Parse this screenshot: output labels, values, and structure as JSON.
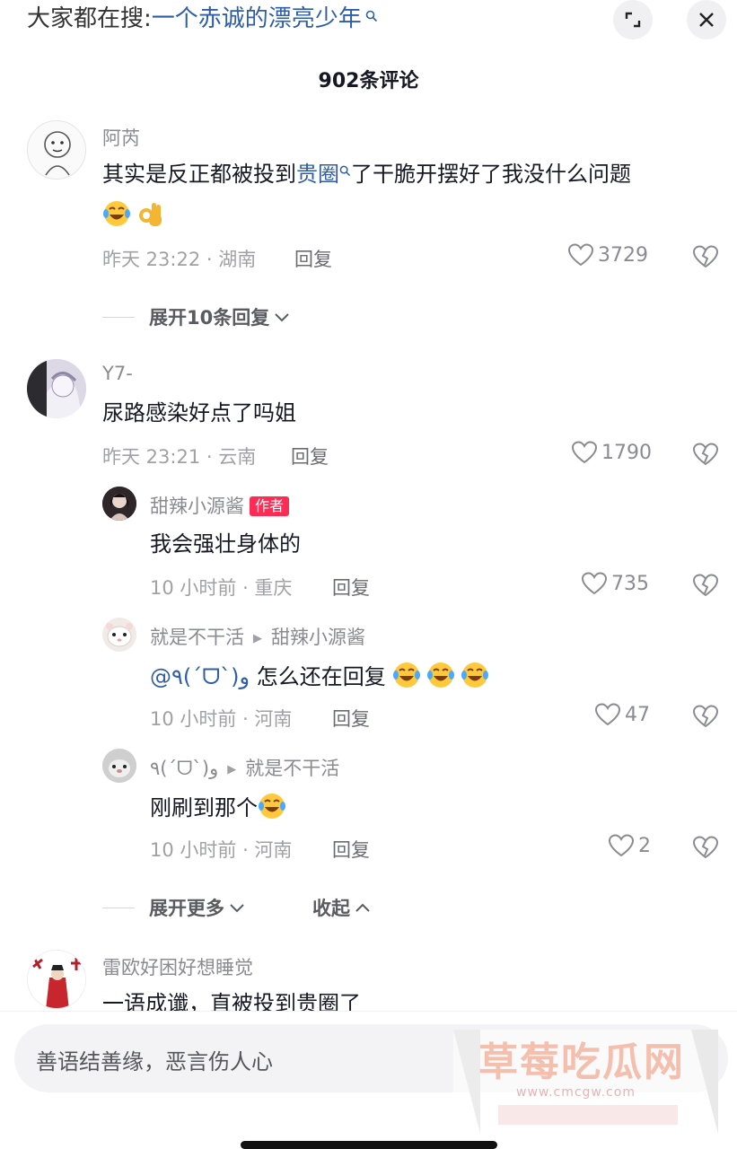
{
  "header": {
    "hint_prefix": "大家都在搜:",
    "hint_keyword": "一个赤诚的漂亮少年",
    "comment_count": "902条评论"
  },
  "comments": [
    {
      "user": "阿芮",
      "text_before": "其实是反正都被投到",
      "link": "贵圈",
      "text_after": "了干脆开摆好了我没什么问题",
      "time_location": "昨天 23:22 · 湖南",
      "reply": "回复",
      "likes": "3729"
    },
    {
      "user": "Y7-",
      "text": "尿路感染好点了吗姐",
      "time_location": "昨天 23:21 · 云南",
      "reply": "回复",
      "likes": "1790"
    },
    {
      "user": "雷欧好困好想睡觉",
      "text": "一语成谶，直被投到贵圈了"
    }
  ],
  "expand_first": "展开10条回复",
  "replies": [
    {
      "user": "甜辣小源酱",
      "badge": "作者",
      "text": "我会强壮身体的",
      "time_location": "10 小时前 · 重庆",
      "reply": "回复",
      "likes": "735"
    },
    {
      "user": "就是不干活",
      "reply_to": "甜辣小源酱",
      "mention": "@٩(ˊᗜˋ)و",
      "text": " 怎么还在回复",
      "time_location": "10 小时前 · 河南",
      "reply": "回复",
      "likes": "47"
    },
    {
      "user": "٩(ˊᗜˋ)و",
      "reply_to": "就是不干活",
      "text": "刚刷到那个",
      "time_location": "10 小时前 · 河南",
      "reply": "回复",
      "likes": "2"
    }
  ],
  "expand_more": "展开更多",
  "collapse": "收起",
  "input": {
    "placeholder": "善语结善缘，恶言伤人心"
  },
  "watermark": {
    "title": "草莓吃瓜网",
    "url": "www.cmcgw.com"
  },
  "colors": {
    "link": "#2f5ea8",
    "author_badge": "#fe2c55"
  },
  "icons": [
    "search-icon",
    "expand-icon",
    "close-icon",
    "heart-icon",
    "broken-heart-icon",
    "chevron-down-icon",
    "chevron-up-icon",
    "laugh-cry-emoji",
    "ok-hand-emoji"
  ]
}
